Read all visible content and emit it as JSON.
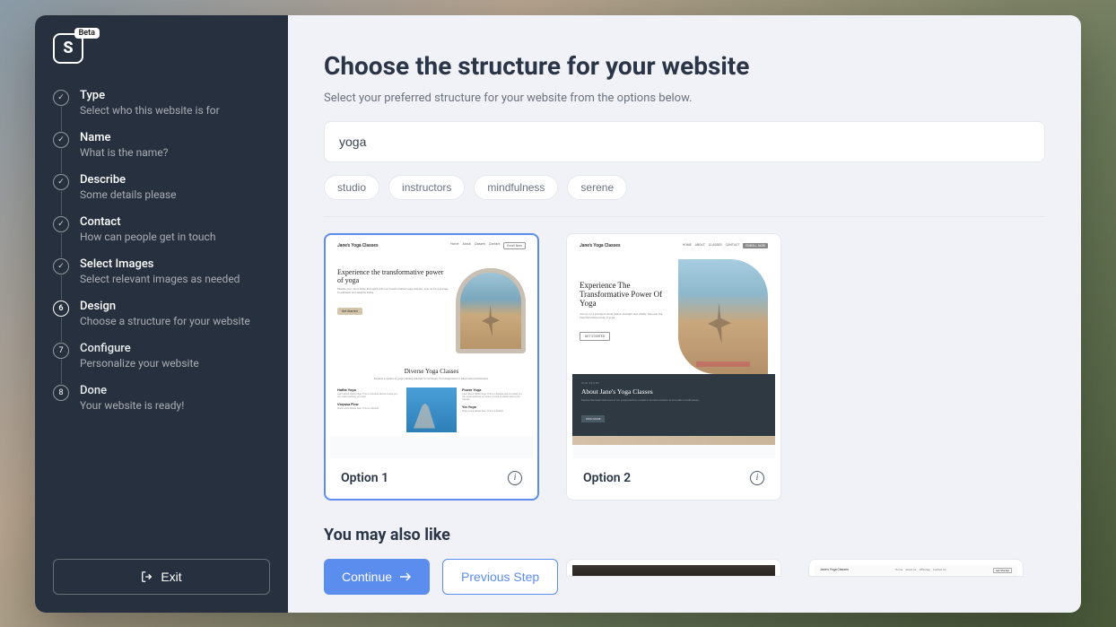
{
  "logo": {
    "letter": "S",
    "badge": "Beta"
  },
  "steps": [
    {
      "number": "",
      "title": "Type",
      "desc": "Select who this website is for",
      "state": "completed"
    },
    {
      "number": "",
      "title": "Name",
      "desc": "What is the name?",
      "state": "completed"
    },
    {
      "number": "",
      "title": "Describe",
      "desc": "Some details please",
      "state": "completed"
    },
    {
      "number": "",
      "title": "Contact",
      "desc": "How can people get in touch",
      "state": "completed"
    },
    {
      "number": "",
      "title": "Select Images",
      "desc": "Select relevant images as needed",
      "state": "completed"
    },
    {
      "number": "6",
      "title": "Design",
      "desc": "Choose a structure for your website",
      "state": "active"
    },
    {
      "number": "7",
      "title": "Configure",
      "desc": "Personalize your website",
      "state": "inactive"
    },
    {
      "number": "8",
      "title": "Done",
      "desc": "Your website is ready!",
      "state": "inactive"
    }
  ],
  "exit_label": "Exit",
  "main": {
    "heading": "Choose the structure for your website",
    "subheading": "Select your preferred structure for your website from the options below.",
    "search_value": "yoga",
    "tags": [
      "studio",
      "instructors",
      "mindfulness",
      "serene"
    ],
    "options": [
      {
        "label": "Option 1",
        "brand": "Jane's Yoga Classes",
        "hero_title": "Experience the transformative power of yoga",
        "hero_desc": "Elevate your mind, body, and spirit with our transformative yoga classes. Join us for a journey to wellness and serenity today.",
        "button": "Get Started",
        "mid_title": "Diverse Yoga Classes",
        "mid_desc": "Explore a variety of yoga classes tailored for all levels, from beginners to advanced practitioners.",
        "col1_title": "Hatha Yoga",
        "col2_title": "Power Yoga",
        "col3_title": "Vinyasa Flow",
        "col4_title": "Yin Yoga",
        "nav": [
          "Home",
          "About",
          "Classes",
          "Contact",
          "Enroll Now"
        ]
      },
      {
        "label": "Option 2",
        "brand": "Jane's Yoga Classes",
        "hero_title": "Experience The Transformative Power Of Yoga",
        "hero_desc": "Join us on a journey to inner peace, strength, and vitality. Discover the transformative power of yoga.",
        "button": "GET STARTED",
        "dark_label": "OUR STORY",
        "dark_title": "About Jane's Yoga Classes",
        "dark_desc": "Explore the heart and soul of our yoga practice, rooted in ancient wisdom and modern mindfulness.",
        "dark_button": "READ MORE",
        "nav": [
          "HOME",
          "ABOUT",
          "CLASSES",
          "CONTACT",
          "ENROLL NOW"
        ]
      }
    ],
    "also_like_heading": "You may also like",
    "also_brand": "Jane's Yoga Classes",
    "also_nav": [
      "Home",
      "About Us",
      "Offerings",
      "Contact Us"
    ],
    "also_btn": "Get Started"
  },
  "footer": {
    "continue": "Continue",
    "previous": "Previous Step"
  }
}
